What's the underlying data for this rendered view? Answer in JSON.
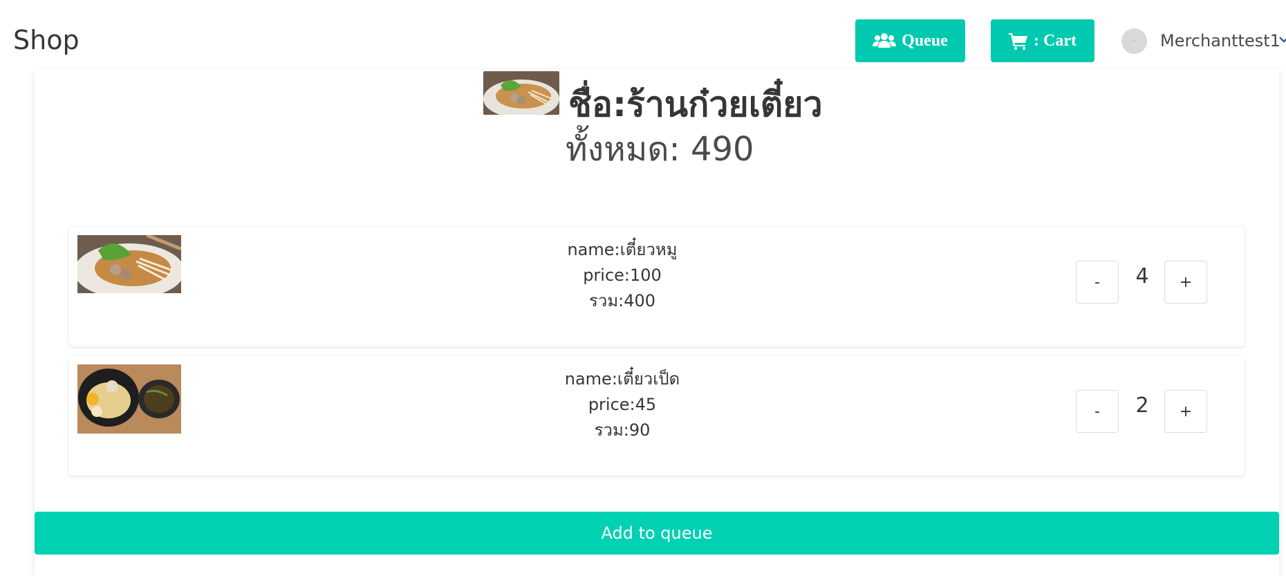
{
  "navbar": {
    "brand": "Shop",
    "queue_label": "Queue",
    "cart_label": ": Cart",
    "username": "Merchanttest1",
    "accent_color": "#00c9b0"
  },
  "store": {
    "name": "ชื่อ:ร้านก๋วยเตี๋ยว",
    "total": "ทั้งหมด: 490"
  },
  "items": [
    {
      "name": "name:เตี๋ยวหมู",
      "price": "price:100",
      "subtotal": "รวม:400",
      "quantity": "4",
      "minus_label": "-",
      "plus_label": "+"
    },
    {
      "name": "name:เตี๋ยวเป็ด",
      "price": "price:45",
      "subtotal": "รวม:90",
      "quantity": "2",
      "minus_label": "-",
      "plus_label": "+"
    }
  ],
  "actions": {
    "add_to_queue": "Add to queue"
  },
  "icons": [
    "users-icon",
    "cart-icon",
    "avatar",
    "chevron-down-icon"
  ]
}
